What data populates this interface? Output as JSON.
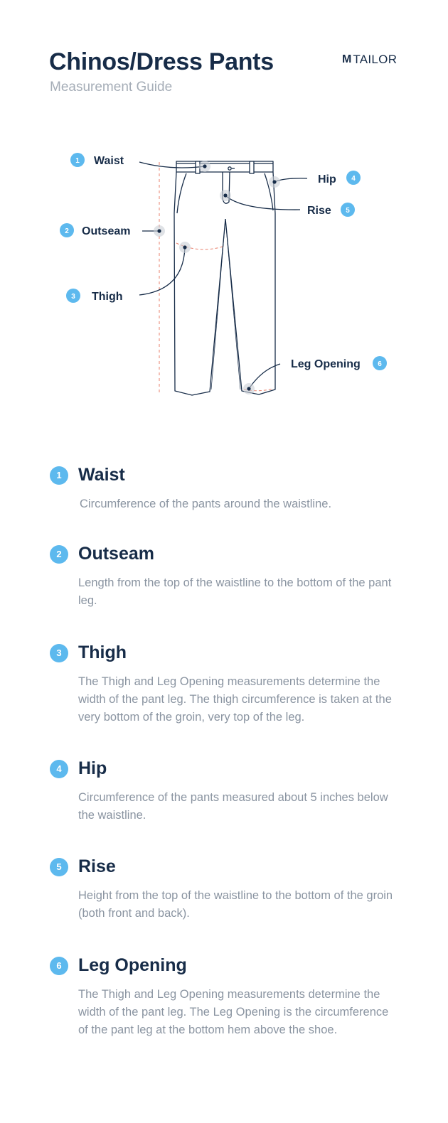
{
  "header": {
    "title": "Chinos/Dress Pants",
    "subtitle": "Measurement Guide",
    "brand": {
      "mark": "M",
      "name": "TAILOR"
    }
  },
  "diagram": {
    "callouts": [
      {
        "number": "1",
        "label": "Waist"
      },
      {
        "number": "2",
        "label": "Outseam"
      },
      {
        "number": "3",
        "label": "Thigh"
      },
      {
        "number": "4",
        "label": "Hip"
      },
      {
        "number": "5",
        "label": "Rise"
      },
      {
        "number": "6",
        "label": "Leg Opening"
      }
    ]
  },
  "measurements": [
    {
      "number": "1",
      "name": "Waist",
      "description": "Circumference of the pants around the waistline."
    },
    {
      "number": "2",
      "name": "Outseam",
      "description": "Length from the top of the waistline to the bottom of the pant leg."
    },
    {
      "number": "3",
      "name": "Thigh",
      "description": "The Thigh and Leg Opening measurements determine the width of the pant leg. The thigh circumference is taken at the very bottom of the groin, very top of the leg."
    },
    {
      "number": "4",
      "name": "Hip",
      "description": "Circumference of the pants measured about 5 inches below the waistline."
    },
    {
      "number": "5",
      "name": "Rise",
      "description": "Height from the top of the waistline to the bottom of the groin (both front and back)."
    },
    {
      "number": "6",
      "name": "Leg Opening",
      "description": "The Thigh and Leg Opening measurements determine the width of the pant leg. The Leg Opening is the circumference of the pant leg at the bottom hem above the shoe."
    }
  ],
  "colors": {
    "navy": "#172c48",
    "accent_blue": "#5db9ee",
    "muted_gray": "#8a94a1",
    "guide_red": "#e8806d"
  }
}
